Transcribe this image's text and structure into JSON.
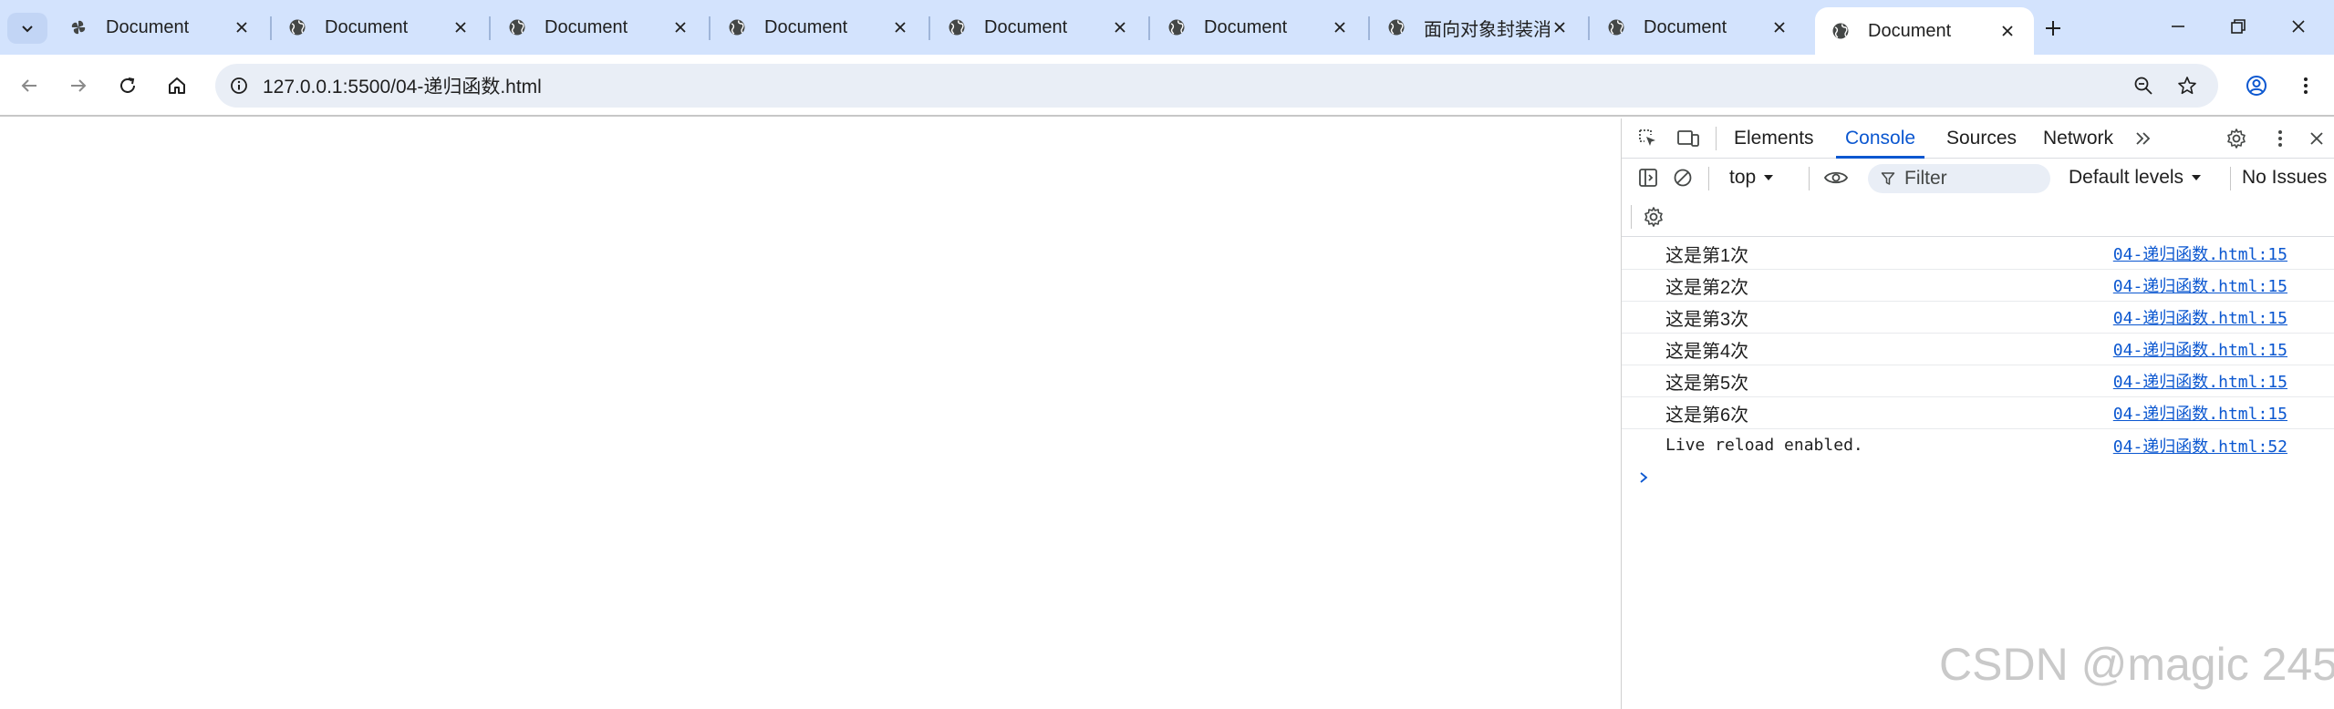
{
  "browser": {
    "tabs": [
      {
        "title": "Document",
        "favicon": "pinwheel-icon"
      },
      {
        "title": "Document",
        "favicon": "globe-icon"
      },
      {
        "title": "Document",
        "favicon": "globe-icon"
      },
      {
        "title": "Document",
        "favicon": "globe-icon"
      },
      {
        "title": "Document",
        "favicon": "globe-icon"
      },
      {
        "title": "Document",
        "favicon": "globe-icon"
      },
      {
        "title": "面向对象封装消息",
        "favicon": "globe-icon"
      },
      {
        "title": "Document",
        "favicon": "globe-icon"
      },
      {
        "title": "Document",
        "favicon": "globe-icon",
        "active": true
      }
    ],
    "url": "127.0.0.1:5500/04-递归函数.html"
  },
  "devtools": {
    "tabs": [
      "Elements",
      "Console",
      "Sources",
      "Network"
    ],
    "active_tab": "Console",
    "context": "top",
    "filter_placeholder": "Filter",
    "levels": "Default levels",
    "issues": "No Issues",
    "messages": [
      {
        "text": "这是第1次",
        "source": "04-递归函数.html:15",
        "mono": false
      },
      {
        "text": "这是第2次",
        "source": "04-递归函数.html:15",
        "mono": false
      },
      {
        "text": "这是第3次",
        "source": "04-递归函数.html:15",
        "mono": false
      },
      {
        "text": "这是第4次",
        "source": "04-递归函数.html:15",
        "mono": false
      },
      {
        "text": "这是第5次",
        "source": "04-递归函数.html:15",
        "mono": false
      },
      {
        "text": "这是第6次",
        "source": "04-递归函数.html:15",
        "mono": false
      },
      {
        "text": "Live reload enabled.",
        "source": "04-递归函数.html:52",
        "mono": true
      }
    ]
  },
  "watermark": "CSDN @magic 245",
  "colors": {
    "accent": "#0b57d0",
    "tabstrip": "#d3e3fd",
    "omnibox": "#e9eef6"
  }
}
